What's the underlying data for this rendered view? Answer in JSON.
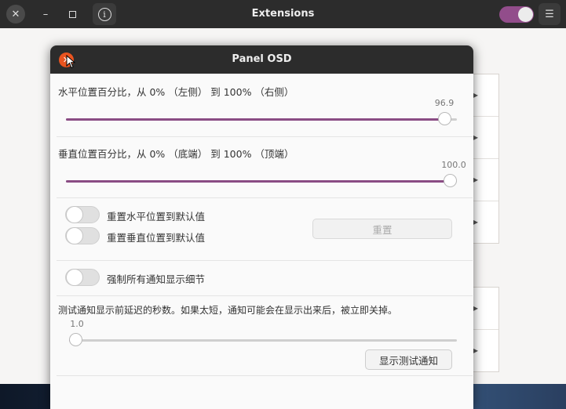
{
  "app": {
    "title": "Extensions",
    "close_icon": "close-icon",
    "minimize_icon": "minimize-icon",
    "maximize_icon": "maximize-icon",
    "info_icon": "info-icon",
    "menu_icon": "hamburger-menu-icon",
    "global_toggle_on": true,
    "accent_color": "#924d8b"
  },
  "dialog": {
    "title": "Panel OSD",
    "close_color": "#e95420",
    "horizontal": {
      "label": "水平位置百分比，从 0% （左侧） 到 100% （右侧）",
      "value": "96.9",
      "fraction": 0.969
    },
    "vertical": {
      "label": "垂直位置百分比，从 0% （底端） 到 100% （顶端）",
      "value": "100.0",
      "fraction": 1.0
    },
    "reset": {
      "reset_h_label": "重置水平位置到默认值",
      "reset_v_label": "重置垂直位置到默认值",
      "reset_button": "重置",
      "reset_h_on": false,
      "reset_v_on": false
    },
    "force_details": {
      "label": "强制所有通知显示细节",
      "on": false
    },
    "delay": {
      "label": "测试通知显示前延迟的秒数。如果太短，通知可能会在显示出来后，被立即关掉。",
      "value": "1.0",
      "fraction": 0.0
    },
    "test_button": "显示测试通知"
  }
}
